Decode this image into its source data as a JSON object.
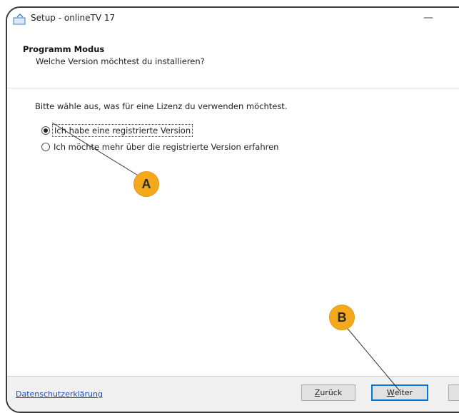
{
  "window": {
    "title": "Setup - onlineTV 17",
    "minimize_label": "—"
  },
  "header": {
    "title": "Programm Modus",
    "subtitle": "Welche Version möchtest du installieren?"
  },
  "content": {
    "prompt": "Bitte wähle aus, was für eine Lizenz du verwenden möchtest.",
    "options": [
      {
        "label": "Ich habe eine registrierte Version",
        "checked": true
      },
      {
        "label": "Ich möchte mehr über die registrierte Version erfahren",
        "checked": false
      }
    ]
  },
  "footer": {
    "privacy_link": "Datenschutzerklärung",
    "back_first": "Z",
    "back_rest": "urück",
    "next_first": "W",
    "next_rest": "eiter"
  },
  "callouts": {
    "a": "A",
    "b": "B"
  },
  "colors": {
    "callout": "#f4a91c",
    "link": "#1a50b0",
    "accent_border": "#0078d7"
  }
}
